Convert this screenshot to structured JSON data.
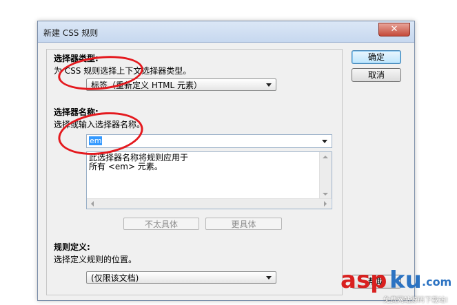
{
  "dialog": {
    "title": "新建 CSS 规则",
    "close_label": "✕"
  },
  "selector_type": {
    "heading": "选择器类型:",
    "description": "为 CSS 规则选择上下文选择器类型。",
    "selected": "标签（重新定义 HTML 元素）"
  },
  "selector_name": {
    "heading": "选择器名称:",
    "description": "选择或输入选择器名称。",
    "value": "em",
    "info_text": "此选择器名称将规则应用于\n所有 <em> 元素。"
  },
  "specificity_buttons": {
    "less_specific": "不太具体",
    "more_specific": "更具体"
  },
  "rule_definition": {
    "heading": "规则定义:",
    "description": "选择定义规则的位置。",
    "selected": "(仅限该文档)"
  },
  "buttons": {
    "ok": "确定",
    "cancel": "取消",
    "help": "帮助"
  },
  "watermark": {
    "asp": "asp",
    "ku": "ku",
    "dot_com": ".com",
    "subtitle": "免费网站源码下载站!"
  },
  "colors": {
    "annotation_red": "#e4191e",
    "selection_blue": "#3399ff",
    "watermark_red": "#d9201f",
    "watermark_blue": "#2c73c2"
  }
}
